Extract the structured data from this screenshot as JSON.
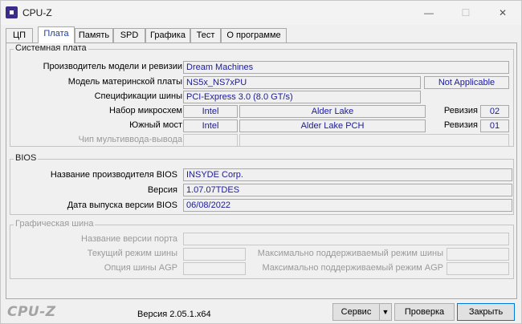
{
  "window": {
    "title": "CPU-Z",
    "minimize": "—",
    "maximize": "☐",
    "close": "✕"
  },
  "tabs": [
    "ЦП",
    "Плата",
    "Память",
    "SPD",
    "Графика",
    "Тест",
    "О программе"
  ],
  "motherboard": {
    "group_title": "Системная плата",
    "manufacturer_label": "Производитель модели и ревизии",
    "manufacturer": "Dream Machines",
    "model_label": "Модель материнской платы",
    "model": "NS5x_NS7xPU",
    "model_rev": "Not Applicable",
    "bus_label": "Спецификации шины",
    "bus": "PCI-Express 3.0 (8.0 GT/s)",
    "chipset_label": "Набор микросхем",
    "chipset_vendor": "Intel",
    "chipset_name": "Alder Lake",
    "chipset_rev_label": "Ревизия",
    "chipset_rev": "02",
    "southbridge_label": "Южный мост",
    "southbridge_vendor": "Intel",
    "southbridge_name": "Alder Lake PCH",
    "southbridge_rev_label": "Ревизия",
    "southbridge_rev": "01",
    "lpcio_label": "Чип мультиввода-вывода"
  },
  "bios": {
    "group_title": "BIOS",
    "vendor_label": "Название производителя BIOS",
    "vendor": "INSYDE Corp.",
    "version_label": "Версия",
    "version": "1.07.07TDES",
    "date_label": "Дата выпуска версии BIOS",
    "date": "06/08/2022"
  },
  "graphic": {
    "group_title": "Графическая шина",
    "version_label": "Название версии порта",
    "link_width_label": "Текущий режим шины",
    "max_supported_label": "Максимально поддерживаемый режим шины",
    "side_band_label": "Опция шины AGP",
    "max_supported_agp_label": "Максимально поддерживаемый режим AGP"
  },
  "footer": {
    "logo": "CPU-Z",
    "version": "Версия 2.05.1.x64",
    "service": "Сервис",
    "dropdown": "▼",
    "validate": "Проверка",
    "close": "Закрыть"
  }
}
